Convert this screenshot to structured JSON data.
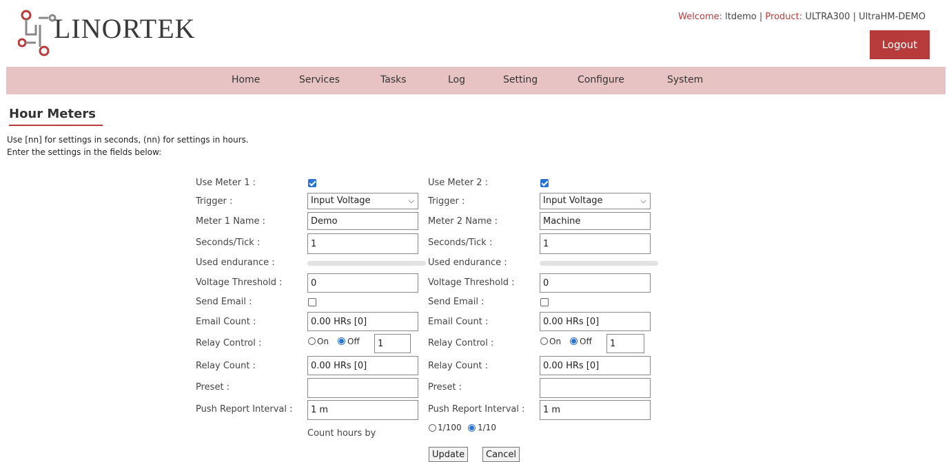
{
  "header": {
    "logo_text": "LINORTEK",
    "welcome_label": "Welcome:",
    "user": "ltdemo",
    "product_label": "Product:",
    "product": "ULTRA300",
    "device": "UltraHM-DEMO",
    "logout_label": "Logout"
  },
  "nav": [
    "Home",
    "Services",
    "Tasks",
    "Log",
    "Setting",
    "Configure",
    "System"
  ],
  "page": {
    "title": "Hour Meters",
    "intro1": "Use [nn] for settings in seconds, (nn) for settings in hours.",
    "intro2": "Enter the settings in the fields below:"
  },
  "meters": [
    {
      "use_label": "Use Meter 1 :",
      "use_checked": true,
      "trigger_label": "Trigger :",
      "trigger_value": "Input Voltage",
      "name_label": "Meter 1 Name :",
      "name_value": "Demo",
      "seconds_label": "Seconds/Tick :",
      "seconds_value": "1",
      "endurance_label": "Used endurance :",
      "endurance_fraction": 0,
      "voltage_label": "Voltage Threshold :",
      "voltage_value": "0",
      "email_label": "Send Email :",
      "email_checked": false,
      "email_count_label": "Email Count :",
      "email_count_value": "0.00 HRs [0]",
      "relay_label": "Relay Control :",
      "relay_on": "On",
      "relay_off": "Off",
      "relay_selected": "Off",
      "relay_value": "1",
      "relay_count_label": "Relay Count :",
      "relay_count_value": "0.00 HRs [0]",
      "preset_label": "Preset :",
      "preset_value": "",
      "push_label": "Push Report Interval :",
      "push_value": "1 m"
    },
    {
      "use_label": "Use Meter 2 :",
      "use_checked": true,
      "trigger_label": "Trigger :",
      "trigger_value": "Input Voltage",
      "name_label": "Meter 2 Name :",
      "name_value": "Machine",
      "seconds_label": "Seconds/Tick :",
      "seconds_value": "1",
      "endurance_label": "Used endurance :",
      "endurance_fraction": 0,
      "voltage_label": "Voltage Threshold :",
      "voltage_value": "0",
      "email_label": "Send Email :",
      "email_checked": false,
      "email_count_label": "Email Count :",
      "email_count_value": "0.00 HRs [0]",
      "relay_label": "Relay Control :",
      "relay_on": "On",
      "relay_off": "Off",
      "relay_selected": "Off",
      "relay_value": "1",
      "relay_count_label": "Relay Count :",
      "relay_count_value": "0.00 HRs [0]",
      "preset_label": "Preset :",
      "preset_value": "",
      "push_label": "Push Report Interval :",
      "push_value": "1 m"
    }
  ],
  "count_hours": {
    "label": "Count hours by",
    "opt1": "1/100",
    "opt2": "1/10",
    "selected": "1/10"
  },
  "actions": {
    "update_label": "Update",
    "cancel_label": "Cancel"
  },
  "colors": {
    "accent": "#b73b3b",
    "nav_bg": "#e8c3c3",
    "check_blue": "#2a74d6"
  }
}
